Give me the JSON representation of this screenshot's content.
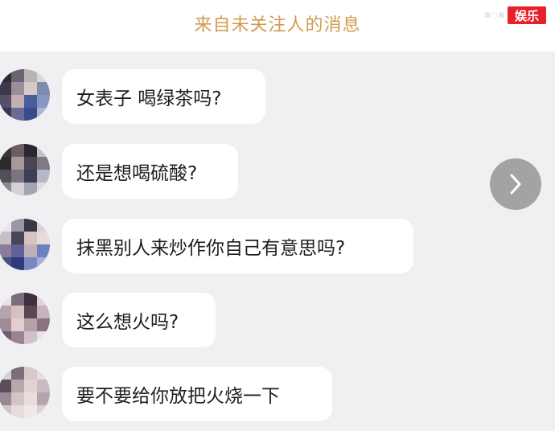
{
  "header": {
    "title": "来自未关注人的消息"
  },
  "watermark": {
    "label": "娱乐"
  },
  "messages": [
    {
      "text": "女表子 喝绿茶吗?"
    },
    {
      "text": "还是想喝硫酸?"
    },
    {
      "text": "抹黑别人来炒作你自己有意思吗?"
    },
    {
      "text": "这么想火吗?"
    },
    {
      "text": "要不要给你放把火烧一下"
    }
  ],
  "colors": {
    "header_text": "#d29a4f",
    "background": "#f0f0f2",
    "bubble": "#ffffff",
    "next_button": "#a3a3a3",
    "watermark": "#e8202a"
  },
  "icons": {
    "next": "chevron-right-icon"
  }
}
